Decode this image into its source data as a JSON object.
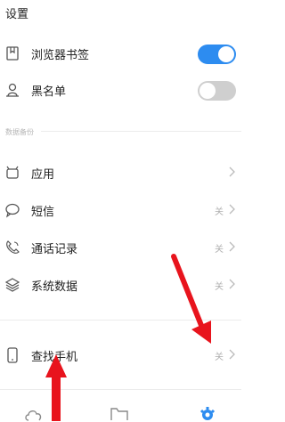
{
  "header": {
    "title": "设置"
  },
  "toggles": [
    {
      "label": "浏览器书签",
      "icon": "bookmark-icon",
      "state": "on"
    },
    {
      "label": "黑名单",
      "icon": "person-icon",
      "state": "off"
    }
  ],
  "section": {
    "title": "数据备份"
  },
  "items": [
    {
      "label": "应用",
      "icon": "app-icon",
      "value": ""
    },
    {
      "label": "短信",
      "icon": "message-icon",
      "value": "关"
    },
    {
      "label": "通话记录",
      "icon": "phone-icon",
      "value": "关"
    },
    {
      "label": "系统数据",
      "icon": "layers-icon",
      "value": "关"
    }
  ],
  "find_phone": {
    "label": "查找手机",
    "icon": "phone-device-icon",
    "value": "关"
  },
  "tabs": [
    {
      "icon": "cloud-icon"
    },
    {
      "icon": "folder-icon"
    },
    {
      "icon": "gear-icon"
    }
  ],
  "colors": {
    "accent": "#2d8cf0",
    "annotation_arrow": "#e8141d"
  }
}
